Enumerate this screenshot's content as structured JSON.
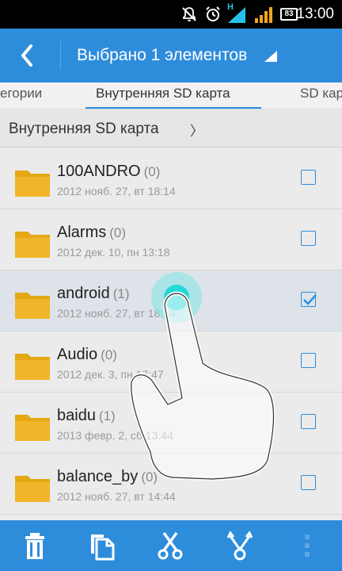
{
  "status_bar": {
    "time": "13:00",
    "battery": "83",
    "network_label": "H",
    "icons": [
      "mute-icon",
      "alarm-icon",
      "signal-icon",
      "signal-icon",
      "battery-icon"
    ]
  },
  "action_bar": {
    "back_icon": "chevron-left-icon",
    "title": "Выбрано 1 элементов",
    "dropdown_icon": "triangle-icon"
  },
  "tabs": [
    {
      "label": "егории"
    },
    {
      "label": "Внутренняя SD карта",
      "active": true
    },
    {
      "label": "SD кар"
    }
  ],
  "breadcrumb": {
    "label": "Внутренняя SD карта",
    "chevron": "〉"
  },
  "files": [
    {
      "name": "100ANDRO",
      "count": "(0)",
      "date": "2012 нояб. 27, вт 18:14",
      "checked": false
    },
    {
      "name": "Alarms",
      "count": "(0)",
      "date": "2012 дек. 10, пн 13:18",
      "checked": false
    },
    {
      "name": "android",
      "count": "(1)",
      "date": "2012 нояб. 27, вт 18:14",
      "checked": true
    },
    {
      "name": "Audio",
      "count": "(0)",
      "date": "2012 дек. 3, пн 17:47",
      "checked": false
    },
    {
      "name": "baidu",
      "count": "(1)",
      "date": "2013 февр. 2, сб 13:44",
      "checked": false
    },
    {
      "name": "balance_by",
      "count": "(0)",
      "date": "2012 нояб. 27, вт 14:44",
      "checked": false
    }
  ],
  "toolbar": {
    "buttons": [
      "trash-icon",
      "copy-icon",
      "scissors-icon",
      "share-icon",
      "more-vert-icon"
    ]
  },
  "colors": {
    "accent": "#2e8ddb",
    "folder": "#e3a814",
    "touch": "#2ee6e6"
  }
}
